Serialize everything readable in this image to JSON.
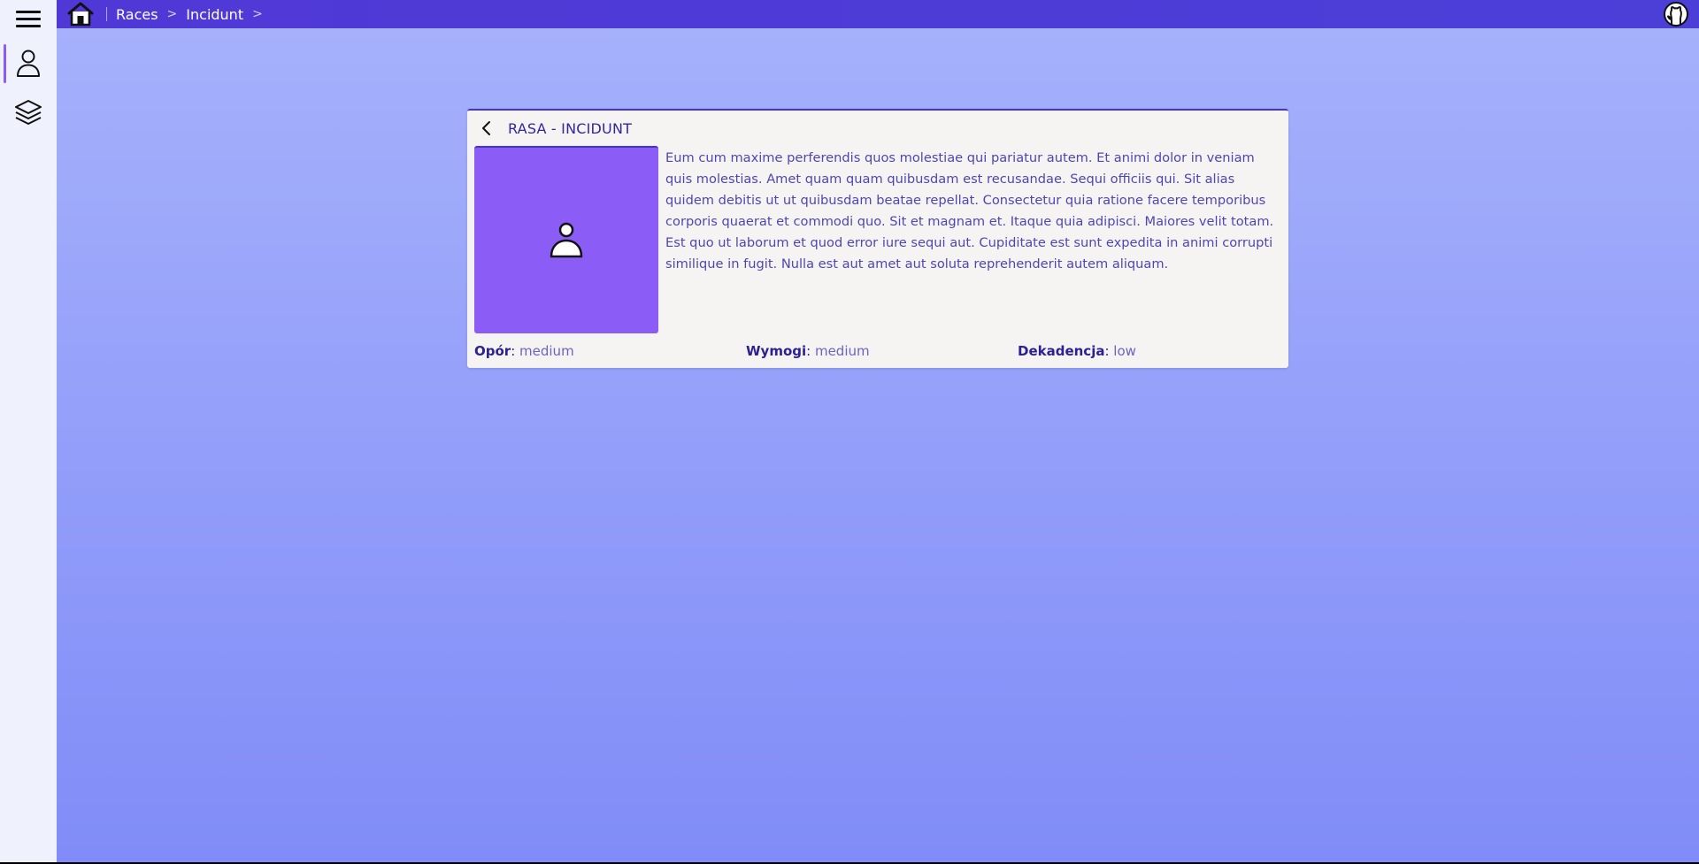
{
  "header": {
    "breadcrumbs": [
      {
        "label": "Races"
      },
      {
        "label": "Incidunt"
      }
    ],
    "separator": ">",
    "icons": {
      "home": "home-icon",
      "github": "github-icon"
    }
  },
  "sidebar": {
    "menu_icon": "hamburger-menu-icon",
    "items": [
      {
        "name": "user-icon",
        "active": true
      },
      {
        "name": "layers-icon",
        "active": false
      }
    ]
  },
  "card": {
    "title": "RASA - INCIDUNT",
    "back_icon": "chevron-left-icon",
    "portrait_icon": "user-icon",
    "portrait_color": "#8b5cf6",
    "description": "Eum cum maxime perferendis quos molestiae qui pariatur autem. Et animi dolor in veniam quis molestias. Amet quam quam quibusdam est recusandae. Sequi officiis qui. Sit alias quidem debitis ut ut quibusdam beatae repellat. Consectetur quia ratione facere temporibus corporis quaerat et commodi quo. Sit et magnam et. Itaque quia adipisci. Maiores velit totam. Est quo ut laborum et quod error iure sequi aut. Cupiditate est sunt expedita in animi corrupti similique in fugit. Nulla est aut amet aut soluta reprehenderit autem aliquam.",
    "stats": [
      {
        "label": "Opór",
        "value": "medium"
      },
      {
        "label": "Wymogi",
        "value": "medium"
      },
      {
        "label": "Dekadencja",
        "value": "low"
      }
    ]
  },
  "colors": {
    "topbar": "#4c3fd8",
    "accent": "#8b5cf6",
    "text_primary": "#33269e",
    "background_top": "#a5b1fb",
    "background_bottom": "#818cf8"
  }
}
